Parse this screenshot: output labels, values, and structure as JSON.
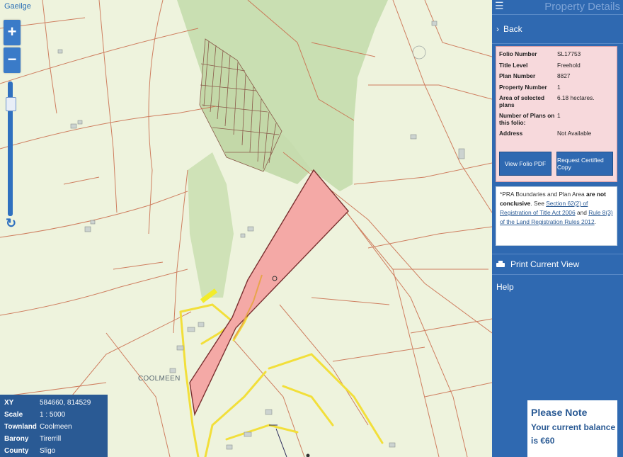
{
  "map": {
    "language_link": "Gaeilge",
    "place_label": "COOLMEEN",
    "zoom_in": "+",
    "zoom_out": "−",
    "colors": {
      "background": "#eef3dd",
      "forest": "#c9dfb2",
      "boundaries": "#c96a4a",
      "selected_plan": "#f4a9a6",
      "roads": "#f2df3a"
    },
    "info": [
      {
        "label": "XY",
        "value": "584660, 814529"
      },
      {
        "label": "Scale",
        "value": "1 : 5000"
      },
      {
        "label": "Townland",
        "value": "Coolmeen"
      },
      {
        "label": "Barony",
        "value": "Tirerrill"
      },
      {
        "label": "County",
        "value": "Sligo"
      }
    ]
  },
  "panel": {
    "title": "Property Details",
    "back": "Back",
    "details": [
      {
        "label": "Folio Number",
        "value": "SL17753"
      },
      {
        "label": "Title Level",
        "value": "Freehold"
      },
      {
        "label": "Plan Number",
        "value": "8827"
      },
      {
        "label": "Property Number",
        "value": "1"
      },
      {
        "label": "Area of selected plans",
        "value": "6.18 hectares."
      },
      {
        "label": "Number of Plans on this folio:",
        "value": "1"
      },
      {
        "label": "Address",
        "value": "Not Available"
      }
    ],
    "buttons": {
      "view_pdf": "View Folio PDF",
      "certified_copy": "Request Certified Copy"
    },
    "notice": {
      "lead": "*PRA Boundaries and Plan Area",
      "bold": "are not conclusive",
      "see": ". See",
      "link1": "Section 62(2) of Registration of Title Act 2006",
      "and": "and",
      "link2": "Rule 8(3) of the Land Registration Rules 2012",
      "end": "."
    },
    "print": "Print Current View",
    "help": "Help"
  },
  "please_note": {
    "title": "Please Note",
    "body": "Your current balance is €60"
  }
}
